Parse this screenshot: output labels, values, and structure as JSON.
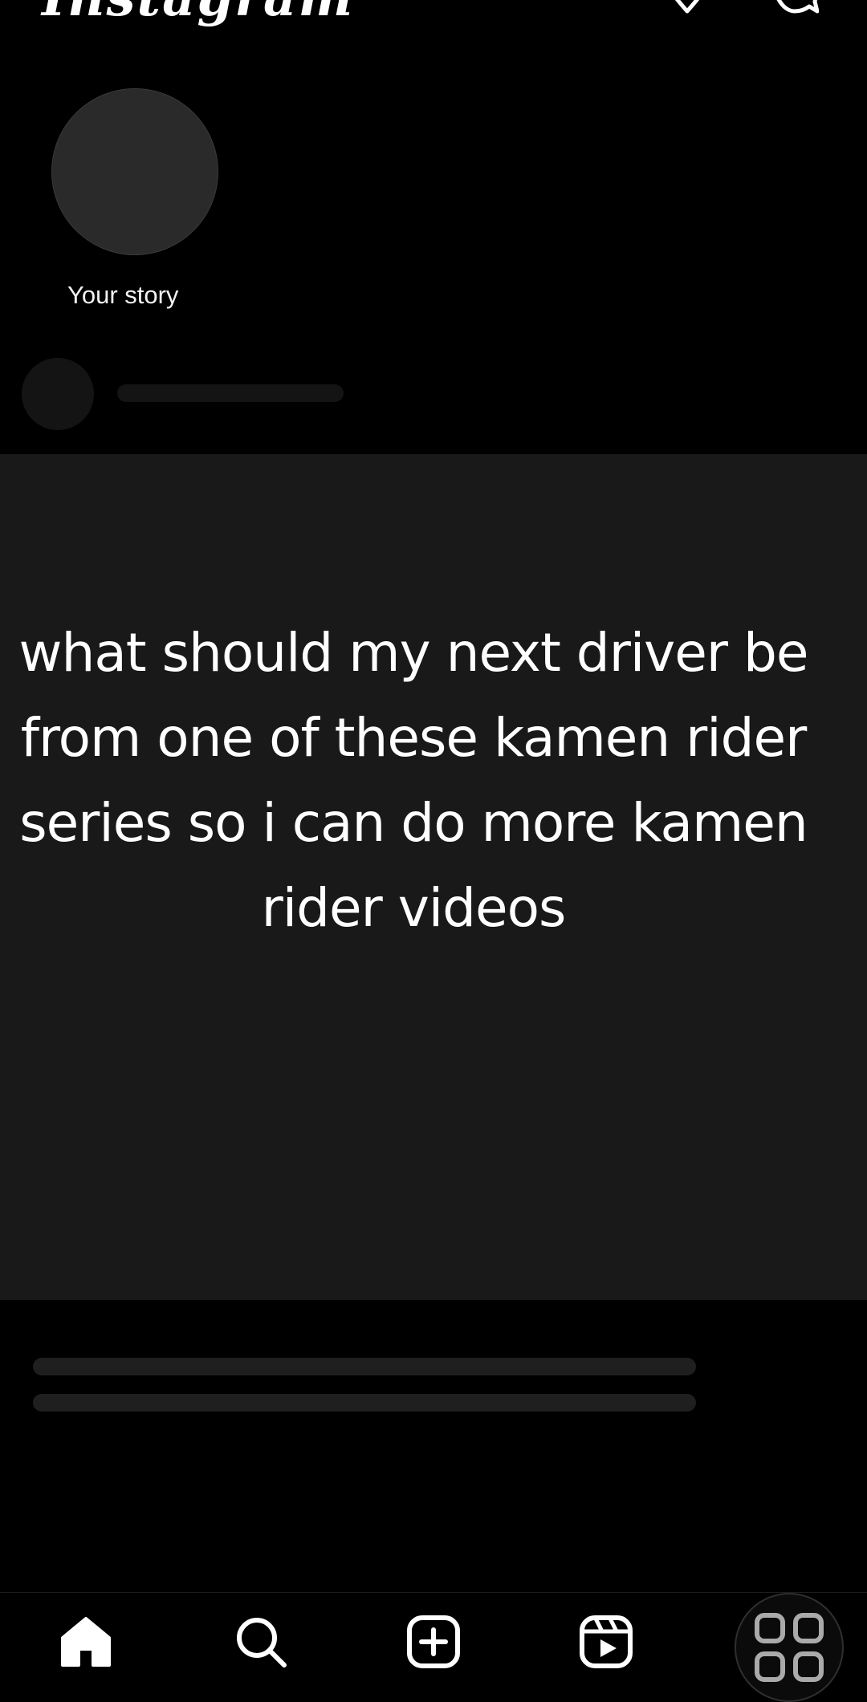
{
  "header": {
    "logo_text": "Instagram",
    "icons": [
      "heart-icon",
      "messenger-icon"
    ]
  },
  "stories": {
    "your_story_label": "Your story"
  },
  "post": {
    "media_text": "what should my next driver be from one of these kamen rider series so i can do more kamen rider videos"
  },
  "bottom_nav": {
    "items": [
      "home-icon",
      "search-icon",
      "create-icon",
      "reels-icon",
      "apps-grid-icon"
    ]
  },
  "colors": {
    "background": "#000000",
    "media_background": "#191919",
    "placeholder": "#1f1f1f"
  }
}
